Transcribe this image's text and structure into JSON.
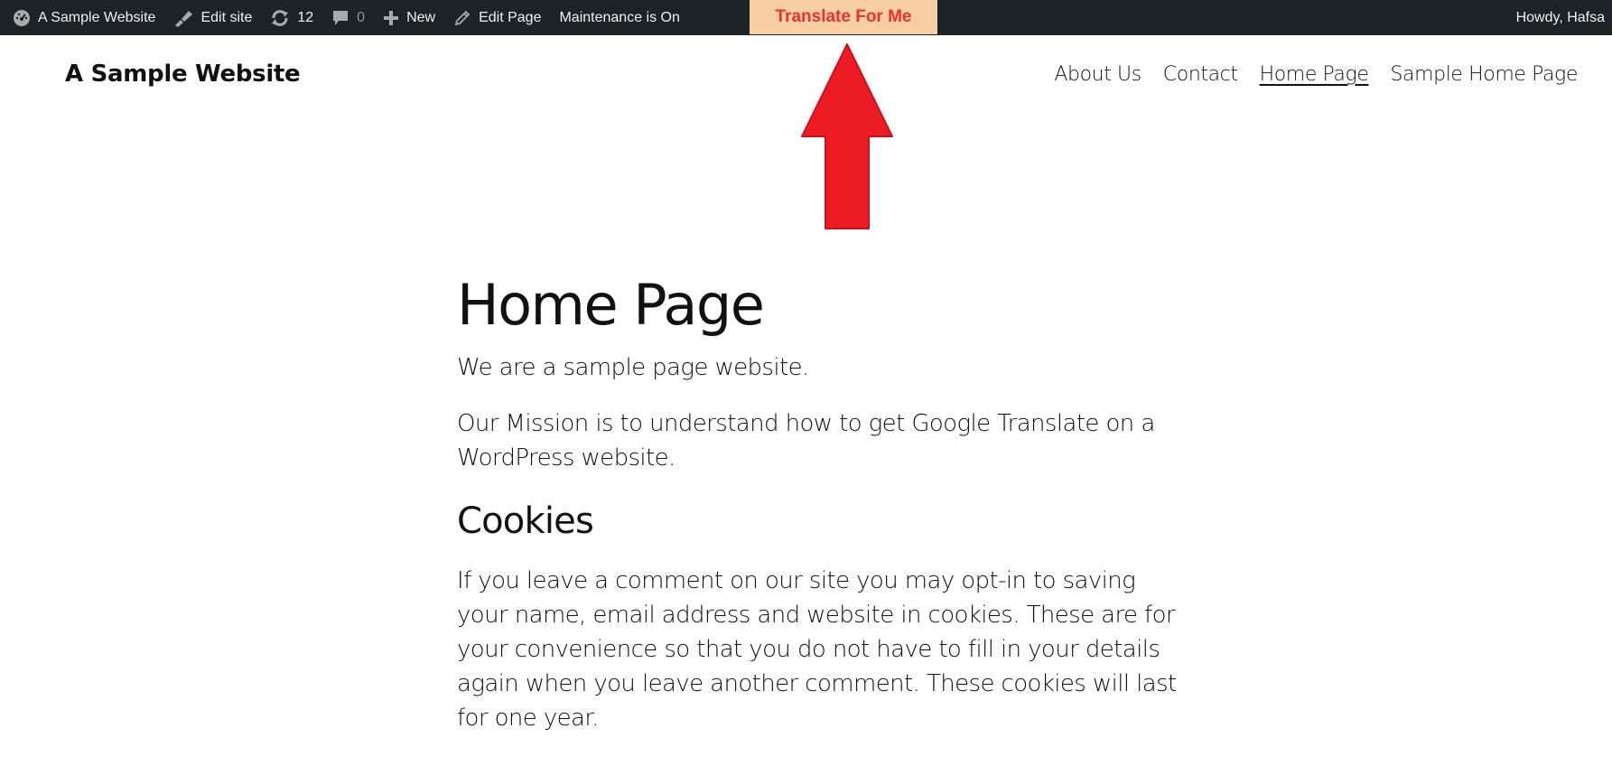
{
  "admin_bar": {
    "site_name": "A Sample Website",
    "edit_site": "Edit site",
    "updates_count": "12",
    "comments_count": "0",
    "new_label": "New",
    "edit_page": "Edit Page",
    "maintenance": "Maintenance is On",
    "translate_button": "Translate For Me",
    "howdy": "Howdy, Hafsa"
  },
  "icons": {
    "dashboard": "dashboard-icon",
    "edit_site": "brush-icon",
    "updates": "refresh-icon",
    "comments": "comment-bubble-icon",
    "new": "plus-icon",
    "edit_page": "pencil-icon",
    "annotation": "red-up-arrow"
  },
  "header": {
    "site_title": "A Sample Website",
    "nav": [
      {
        "label": "About Us"
      },
      {
        "label": "Contact"
      },
      {
        "label": "Home Page"
      },
      {
        "label": "Sample Home Page"
      }
    ],
    "current_nav": "Home Page"
  },
  "content": {
    "title": "Home Page",
    "paragraphs": [
      "We are a sample page website.",
      "Our Mission is to understand how to get Google Translate on a WordPress website."
    ],
    "section_title": "Cookies",
    "section_text": "If you leave a comment on our site you may opt-in to saving your name, email address and website in cookies. These are for your convenience so that you do not have to fill in your details again when you leave another comment. These cookies will last for one year."
  },
  "colors": {
    "admin_bar_bg": "#1d2327",
    "translate_bg": "#f8cfa2",
    "translate_text": "#ea2f36",
    "arrow": "#ed1c24"
  }
}
